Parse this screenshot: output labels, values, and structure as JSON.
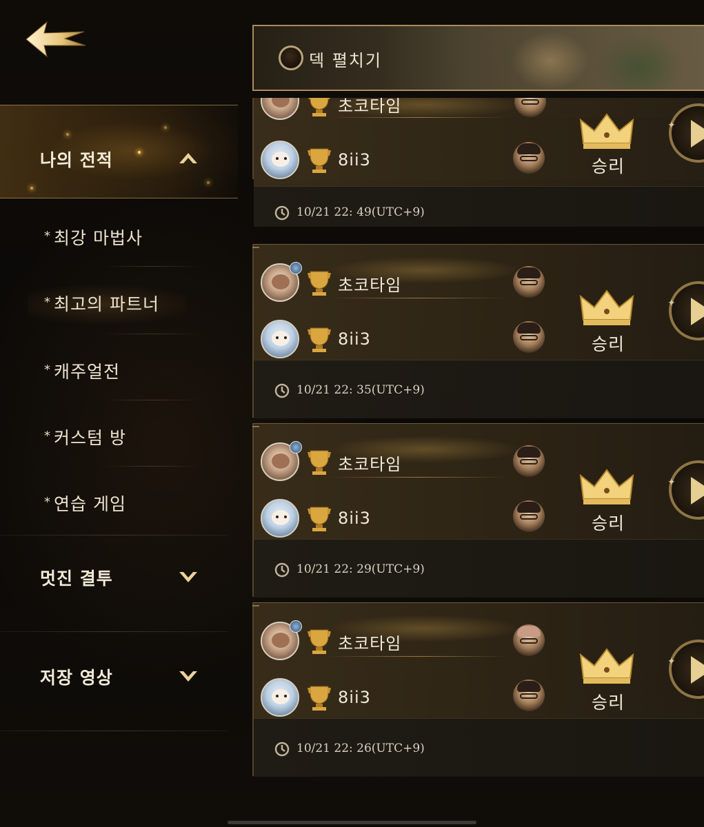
{
  "nav": {
    "my_record": "나의 전적",
    "sub_items": [
      "최강 마법사",
      "최고의 파트너",
      "캐주얼전",
      "커스텀 방",
      "연습 게임"
    ],
    "awesome_duel": "멋진 결투",
    "saved_video": "저장 영상"
  },
  "deck": {
    "label": "덱 펼치기"
  },
  "matches": [
    {
      "player1": "초코타임",
      "player2": "8ii3",
      "result": "승리",
      "time": "10/21 22: 49(UTC+9)"
    },
    {
      "player1": "초코타임",
      "player2": "8ii3",
      "result": "승리",
      "time": "10/21 22: 35(UTC+9)"
    },
    {
      "player1": "초코타임",
      "player2": "8ii3",
      "result": "승리",
      "time": "10/21 22: 29(UTC+9)"
    },
    {
      "player1": "초코타임",
      "player2": "8ii3",
      "result": "승리",
      "time": "10/21 22: 26(UTC+9)"
    }
  ],
  "colors": {
    "gold": "#d9b865",
    "panel": "#2e2517",
    "accent_text": "#f1e9d8"
  },
  "icons": [
    "back-arrow-icon",
    "chevron-up-icon",
    "chevron-down-icon",
    "trophy-icon",
    "crown-icon",
    "play-icon",
    "clock-icon"
  ]
}
